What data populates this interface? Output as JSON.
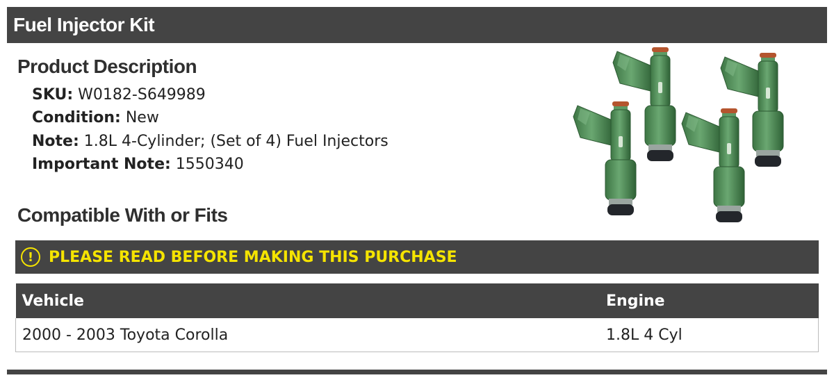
{
  "header": {
    "title": "Fuel Injector Kit"
  },
  "description": {
    "heading": "Product Description",
    "specs": [
      {
        "label": "SKU:",
        "value": "W0182-S649989"
      },
      {
        "label": "Condition:",
        "value": "New"
      },
      {
        "label": "Note:",
        "value": "1.8L 4-Cylinder; (Set of 4) Fuel Injectors"
      },
      {
        "label": "Important Note:",
        "value": "1550340"
      }
    ]
  },
  "compatibility": {
    "heading": "Compatible With or Fits",
    "notice_icon": "!",
    "notice": "PLEASE READ BEFORE MAKING THIS PURCHASE",
    "columns": {
      "vehicle": "Vehicle",
      "engine": "Engine"
    },
    "rows": [
      {
        "vehicle": "2000 - 2003 Toyota Corolla",
        "engine": "1.8L 4 Cyl"
      }
    ]
  },
  "colors": {
    "bar": "#444444",
    "notice_accent": "#f5e400",
    "injector_body": "#4e8a55"
  }
}
